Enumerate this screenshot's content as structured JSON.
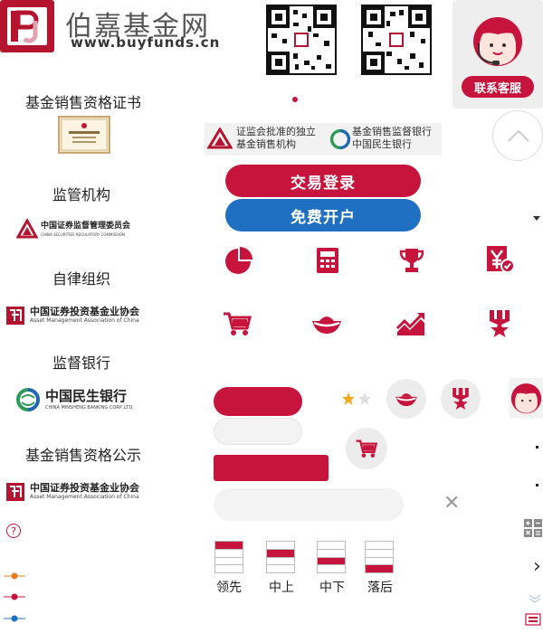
{
  "header": {
    "brand_name": "伯嘉基金网",
    "brand_url": "www.buyfunds.cn",
    "service_label": "联系客服"
  },
  "left": {
    "cert_title": "基金销售资格证书",
    "regulator_title": "监管机构",
    "regulator_cn": "中国证券监督管理委员会",
    "regulator_en": "CHINA SECURITIES REGULATORY COMMISSION",
    "selfreg_title": "自律组织",
    "assoc_cn": "中国证券投资基金业协会",
    "assoc_en": "Asset Management Association of China",
    "bank_title": "监督银行",
    "bank_cn": "中国民生银行",
    "bank_en": "CHINA MINSHENG BANKING CORP.,LTD.",
    "pub_title": "基金销售资格公示",
    "assoc2_cn": "中国证券投资基金业协会",
    "assoc2_en": "Asset Management Association of China",
    "help_glyph": "?"
  },
  "center": {
    "approval_1": "证监会批准的独立",
    "approval_2": "基金销售机构",
    "approval_3": "基金销售监督银行",
    "approval_4": "中国民生银行",
    "login_label": "交易登录",
    "open_label": "免费开户",
    "close_glyph": "✕"
  },
  "icons_row1": [
    "pie-chart-icon",
    "calculator-icon",
    "trophy-icon",
    "yen-badge-icon"
  ],
  "icons_row2": [
    "cart-icon",
    "gold-ingot-icon",
    "trend-up-icon",
    "medal-icon"
  ],
  "rating": {
    "filled": 1,
    "total": 2
  },
  "bars": [
    {
      "label": "领先",
      "filled_row": 0
    },
    {
      "label": "中上",
      "filled_row": 1
    },
    {
      "label": "中下",
      "filled_row": 2
    },
    {
      "label": "落后",
      "filled_row": 3
    }
  ],
  "colors": {
    "brand_red": "#c7143c",
    "brand_blue": "#1f6fc2",
    "legend": [
      "#e67e22",
      "#c7143c",
      "#1f6fc2"
    ]
  },
  "right": {
    "chevron_glyph": "›"
  }
}
